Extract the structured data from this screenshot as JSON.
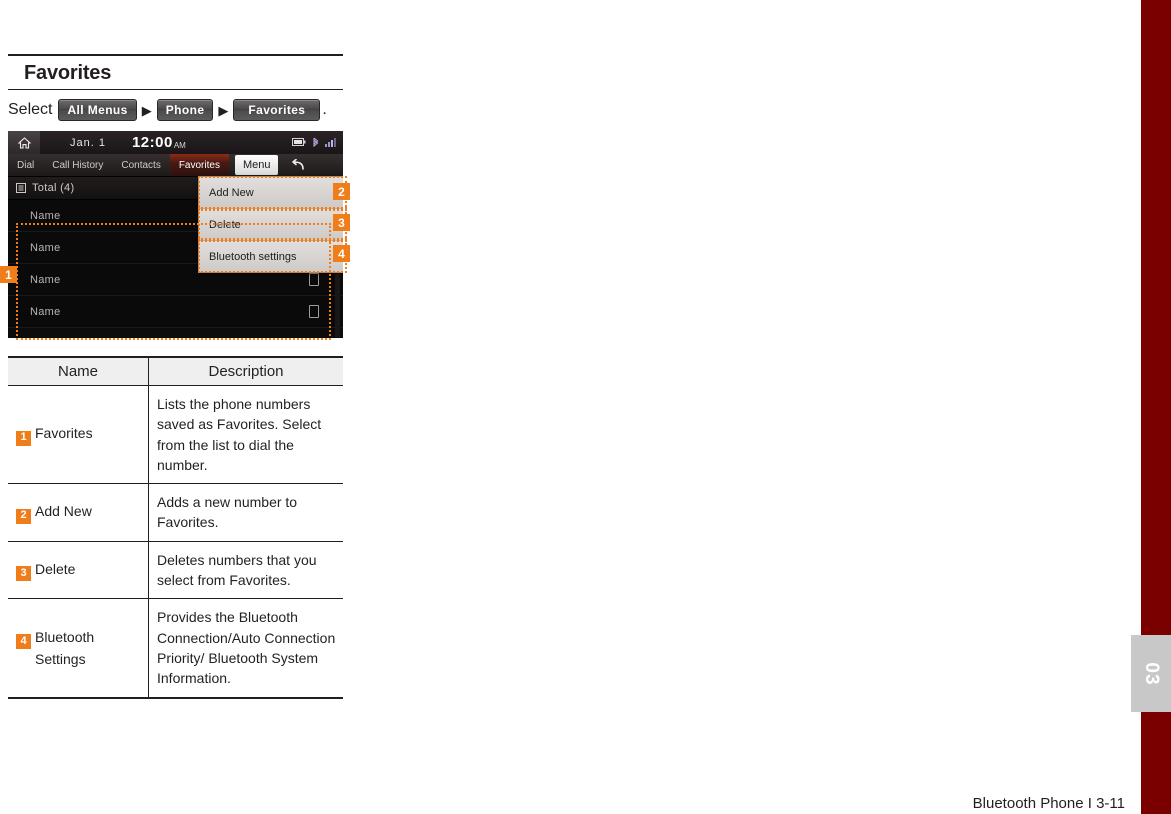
{
  "page": {
    "title": "Favorites",
    "footer": "Bluetooth Phone I 3-11",
    "chapter_tab": "03",
    "accent_color": "#ef7d1a",
    "edge_bar_color": "#7a0000"
  },
  "breadcrumb": {
    "select_word": "Select",
    "arrow": "▶",
    "period": ".",
    "crumbs": [
      {
        "label": "All Menus"
      },
      {
        "label": "Phone"
      },
      {
        "label": "Favorites"
      }
    ]
  },
  "device": {
    "status_bar": {
      "home_icon": "home-icon",
      "date": "Jan.  1",
      "time": "12:00",
      "ampm": "AM",
      "icons": [
        "battery-icon",
        "bluetooth-icon",
        "signal-icon"
      ]
    },
    "tabs": [
      {
        "label": "Dial",
        "active": false
      },
      {
        "label": "Call History",
        "active": false
      },
      {
        "label": "Contacts",
        "active": false
      },
      {
        "label": "Favorites",
        "active": true
      }
    ],
    "menu_button": "Menu",
    "back_button": "back-arrow-icon",
    "total_label": "Total (4)",
    "list_icon": "list-icon",
    "list_rows": [
      {
        "name": "Name",
        "has_chip": false
      },
      {
        "name": "Name",
        "has_chip": false
      },
      {
        "name": "Name",
        "has_chip": true
      },
      {
        "name": "Name",
        "has_chip": true
      }
    ],
    "popup_items": [
      {
        "label": "Add New"
      },
      {
        "label": "Delete"
      },
      {
        "label": "Bluetooth settings"
      }
    ],
    "badges": [
      "1",
      "2",
      "3",
      "4"
    ]
  },
  "table": {
    "headers": {
      "name": "Name",
      "description": "Description"
    },
    "rows": [
      {
        "badge": "1",
        "name": "Favorites",
        "name_line2": "",
        "description": "Lists the phone numbers saved as Favorites. Select from the list to dial the number."
      },
      {
        "badge": "2",
        "name": "Add New",
        "name_line2": "",
        "description": "Adds a new number to Favorites."
      },
      {
        "badge": "3",
        "name": "Delete",
        "name_line2": "",
        "description": "Deletes numbers that you select from Favorites."
      },
      {
        "badge": "4",
        "name": "Bluetooth",
        "name_line2": "Settings",
        "description": "Provides the Bluetooth Connection/Auto Connection Priority/ Bluetooth System Information."
      }
    ]
  }
}
